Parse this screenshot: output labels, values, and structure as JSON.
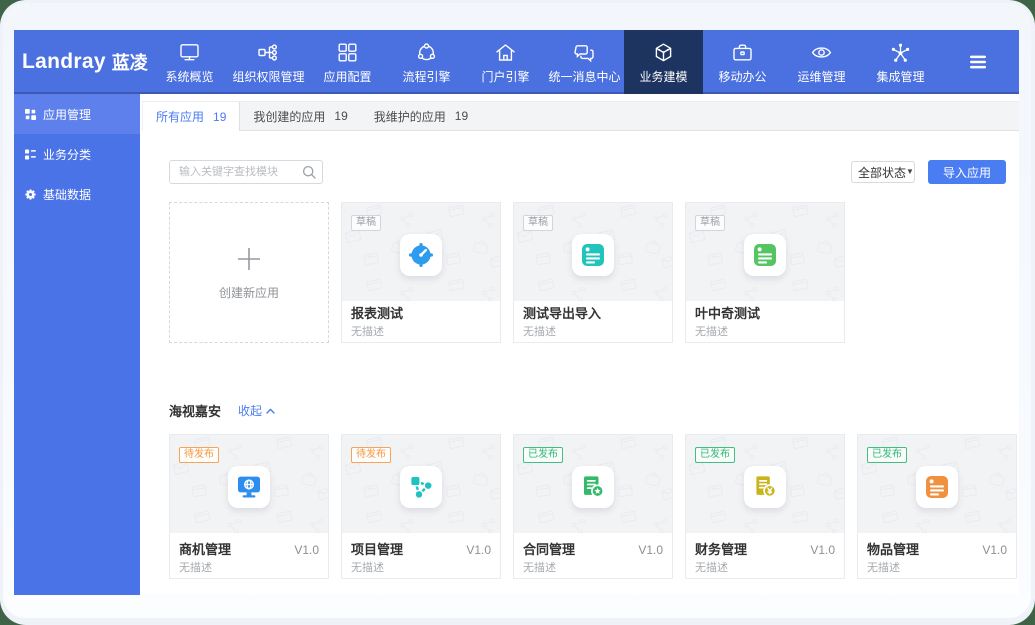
{
  "page": {
    "corner_background": "#3f6346",
    "window_background": "#f6f9fd"
  },
  "brand": {
    "logo_en": "Landray",
    "logo_cn": "蓝凌"
  },
  "topnav": {
    "background_color": "#4b70e0",
    "active_background_color": "#1d3460",
    "items": [
      {
        "label": "系统概览",
        "icon": "monitor-icon",
        "active": false
      },
      {
        "label": "组织权限管理",
        "icon": "org-chart-icon",
        "active": false
      },
      {
        "label": "应用配置",
        "icon": "app-grid-icon",
        "active": false
      },
      {
        "label": "流程引擎",
        "icon": "flow-icon",
        "active": false
      },
      {
        "label": "门户引擎",
        "icon": "home-icon",
        "active": false
      },
      {
        "label": "统一消息中心",
        "icon": "messages-icon",
        "active": false
      },
      {
        "label": "业务建模",
        "icon": "cube-icon",
        "active": true
      },
      {
        "label": "移动办公",
        "icon": "briefcase-icon",
        "active": false
      },
      {
        "label": "运维管理",
        "icon": "eye-icon",
        "active": false
      },
      {
        "label": "集成管理",
        "icon": "network-icon",
        "active": false
      }
    ]
  },
  "sidebar": {
    "background_color": "#4a73e8",
    "active_background_color": "#5d80ec",
    "items": [
      {
        "label": "应用管理",
        "icon": "apps-icon",
        "active": true
      },
      {
        "label": "业务分类",
        "icon": "category-list-icon",
        "active": false
      },
      {
        "label": "基础数据",
        "icon": "gear-icon",
        "active": false
      }
    ]
  },
  "main": {
    "tabs": [
      {
        "label": "所有应用",
        "count": "19",
        "active": true
      },
      {
        "label": "我创建的应用",
        "count": "19",
        "active": false
      },
      {
        "label": "我维护的应用",
        "count": "19",
        "active": false
      }
    ],
    "toolbar": {
      "search_placeholder": "输入关键字查找模块",
      "status_select_value": "全部状态",
      "import_button_label": "导入应用",
      "accent_color": "#4a7df2"
    },
    "create_card": {
      "label": "创建新应用"
    },
    "groups": [
      {
        "cards": [
          {
            "name": "报表测试",
            "tag": "草稿",
            "tag_type": "draft",
            "description": "无描述",
            "icon": "gauge-icon",
            "icon_color": "#2d9ced"
          },
          {
            "name": "测试导出导入",
            "tag": "草稿",
            "tag_type": "draft",
            "description": "无描述",
            "icon": "note-icon",
            "icon_color": "#21c4bd"
          },
          {
            "name": "叶中奇测试",
            "tag": "草稿",
            "tag_type": "draft",
            "description": "无描述",
            "icon": "note-icon",
            "icon_color": "#55c561"
          }
        ]
      },
      {
        "title": "海视嘉安",
        "collapse_label": "收起",
        "cards": [
          {
            "name": "商机管理",
            "version": "V1.0",
            "tag": "待发布",
            "tag_type": "pending",
            "description": "无描述",
            "icon": "monitor-globe-icon",
            "icon_color": "#2d8ef0"
          },
          {
            "name": "项目管理",
            "version": "V1.0",
            "tag": "待发布",
            "tag_type": "pending",
            "description": "无描述",
            "icon": "cycle-icon",
            "icon_color": "#1fc2c2"
          },
          {
            "name": "合同管理",
            "version": "V1.0",
            "tag": "已发布",
            "tag_type": "published",
            "description": "无描述",
            "icon": "doc-star-icon",
            "icon_color": "#31ba68"
          },
          {
            "name": "财务管理",
            "version": "V1.0",
            "tag": "已发布",
            "tag_type": "published",
            "description": "无描述",
            "icon": "doc-coin-icon",
            "icon_color": "#c9b41c"
          },
          {
            "name": "物品管理",
            "version": "V1.0",
            "tag": "已发布",
            "tag_type": "published",
            "description": "无描述",
            "icon": "note-icon",
            "icon_color": "#ef913f"
          }
        ]
      }
    ]
  }
}
